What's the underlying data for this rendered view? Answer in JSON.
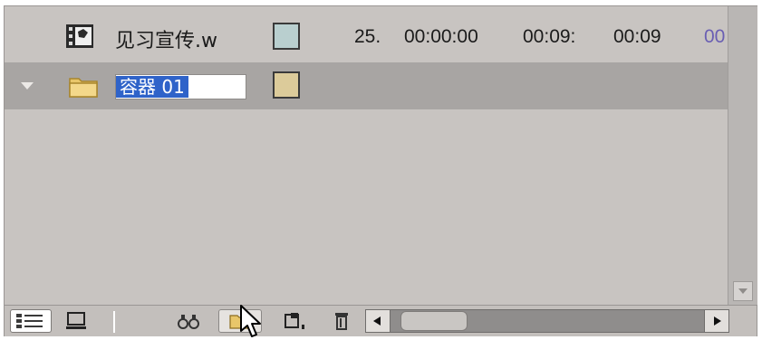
{
  "rows": [
    {
      "icon": "film-icon",
      "name": "见习宣传.w",
      "label_color": "#b9cfcf",
      "cells": [
        "25.",
        "00:00:00",
        "00:09:",
        "00:09",
        "00"
      ]
    },
    {
      "icon": "folder-icon",
      "name": "容器 01",
      "label_color": "#dccb9a",
      "expanded": true,
      "selected_for_rename": true
    }
  ],
  "colors": {
    "panel": "#c8c4c1",
    "selected_row": "#a8a5a3",
    "selection": "#2f63c9",
    "last_cell_text": "#6a5fb3"
  },
  "bottom_bar": {
    "buttons": [
      "list-view-icon",
      "icon-view-icon",
      "find-icon",
      "new-folder-icon",
      "new-composition-icon",
      "delete-icon"
    ],
    "horizontal_scroll": {
      "left": "scroll-left-arrow",
      "right": "scroll-right-arrow"
    }
  }
}
